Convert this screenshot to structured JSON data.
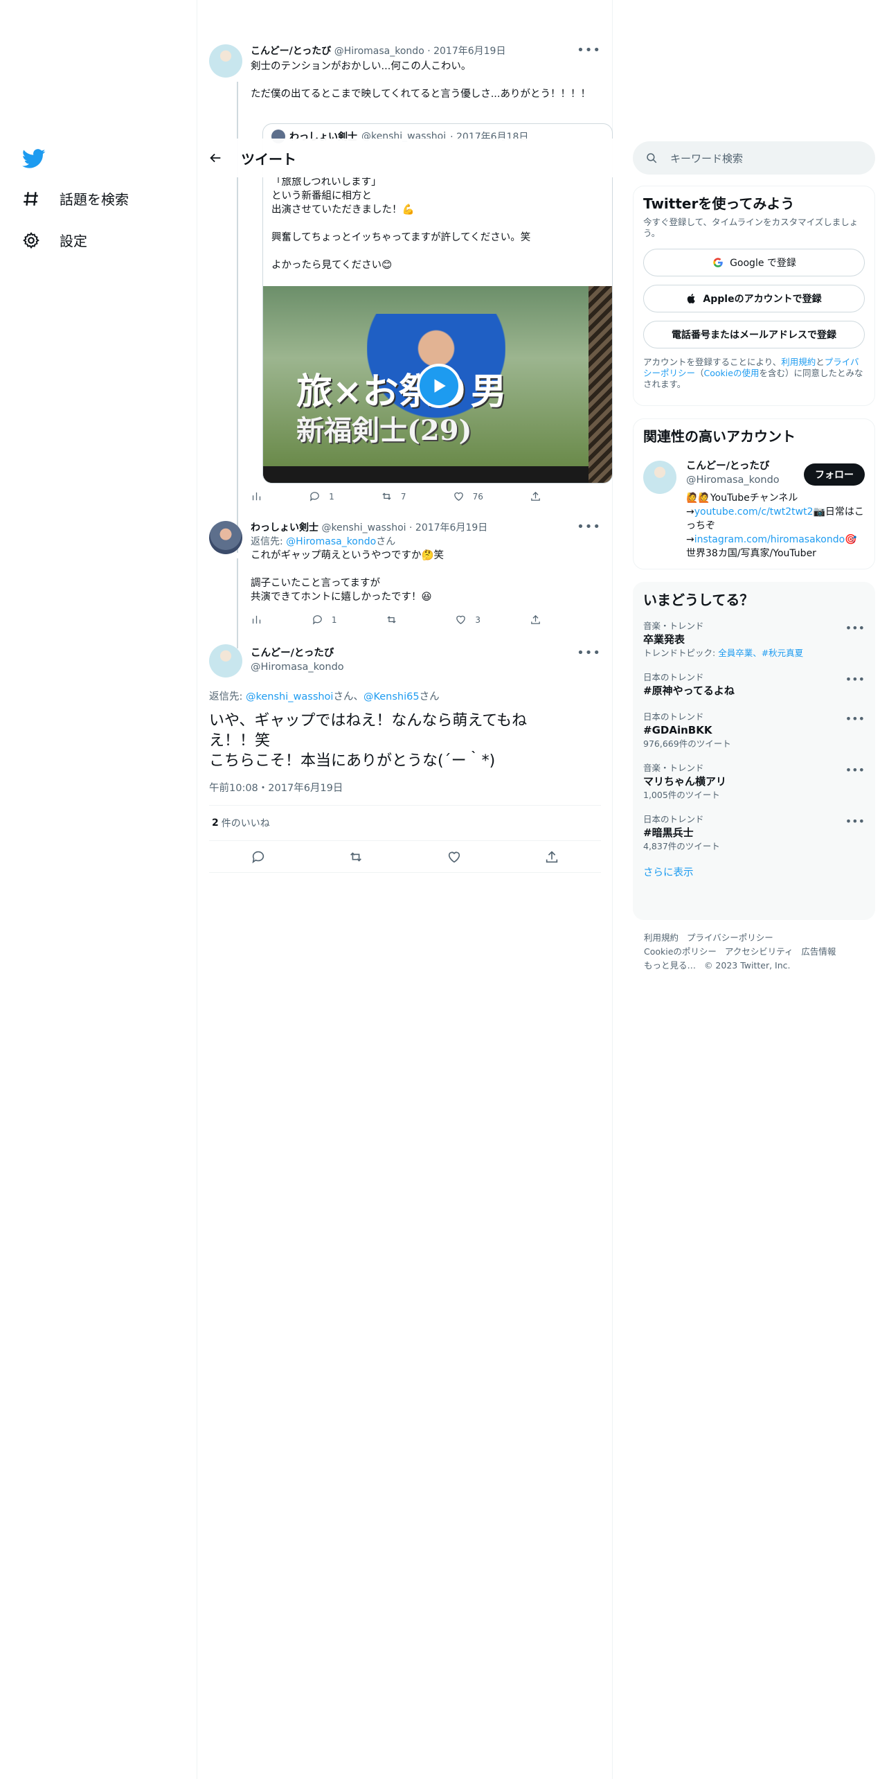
{
  "nav": {
    "explore": "話題を検索",
    "settings": "設定"
  },
  "header": {
    "title": "ツイート"
  },
  "tweet1": {
    "name": "こんどー/とったび",
    "handle": "@Hiromasa_kondo",
    "date": "· 2017年6月19日",
    "text": "剣士のテンションがおかしい...何この人こわい。\n\nただ僕の出てるとこまで映してくれてると言う優しさ...ありがとう！！！！",
    "quote": {
      "name": "わっしょい剣士",
      "handle": "@kenshi_wasshoi",
      "date": "· 2017年6月18日",
      "text": "「旅旅しつれいします」\nという新番組に相方と\n出演させていただきました！💪\n\n興奮してちょっとイッちゃってますが許してください。笑\n\nよかったら見てください😊",
      "overlay_line1": "旅×お祭り男",
      "overlay_line2": "新福剣士(29)"
    },
    "replies": "1",
    "retweets": "7",
    "likes": "76"
  },
  "tweet2": {
    "name": "わっしょい剣士",
    "handle": "@kenshi_wasshoi",
    "date": "· 2017年6月19日",
    "reply_prefix": "返信先: ",
    "reply_to": "@Hiromasa_kondo",
    "reply_suffix": "さん",
    "text": "これがギャップ萌えというやつですか🤔笑\n\n調子こいたこと言ってますが\n共演できてホントに嬉しかったです！😆",
    "replies": "1",
    "retweets": "",
    "likes": "3"
  },
  "main_tweet": {
    "name": "こんどー/とったび",
    "handle": "@Hiromasa_kondo",
    "reply_prefix": "返信先: ",
    "reply_to1": "@kenshi_wasshoi",
    "reply_mid": "さん、",
    "reply_to2": "@Kenshi65",
    "reply_suffix": "さん",
    "text": "いや、ギャップではねえ！なんなら萌えてもねえ！！笑\nこちらこそ！本当にありがとうな(´ー｀*)",
    "timestamp": "午前10:08・2017年6月19日",
    "likes_count": "2",
    "likes_label": "件のいいね"
  },
  "search": {
    "placeholder": "キーワード検索"
  },
  "signup": {
    "title": "Twitterを使ってみよう",
    "subtitle": "今すぐ登録して、タイムラインをカスタマイズしましょう。",
    "google": "Google で登録",
    "apple": "Appleのアカウントで登録",
    "phone": "電話番号またはメールアドレスで登録",
    "terms_pre": "アカウントを登録することにより、",
    "terms": "利用規約",
    "terms_and": "と",
    "privacy": "プライバシーポリシー",
    "cookie_pre": "（",
    "cookie": "Cookieの使用",
    "cookie_post": "を含む）に同意したとみなされます。"
  },
  "related": {
    "title": "関連性の高いアカウント",
    "name": "こんどー/とったび",
    "handle": "@Hiromasa_kondo",
    "follow": "フォロー",
    "bio1": "🙋🙋YouTubeチャンネル",
    "bio2_pre": "→",
    "bio2_link": "youtube.com/c/twt2twt2",
    "bio2_post": "📷日常はこっちぞ",
    "bio3_pre": "→",
    "bio3_link": "instagram.com/hiromasakondo",
    "bio3_post": "🎯",
    "bio4": "世界38カ国/写真家/YouTuber"
  },
  "trends": {
    "title": "いまどうしてる？",
    "items": [
      {
        "category": "音楽・トレンド",
        "name": "卒業発表",
        "extra_pre": "トレンドトピック: ",
        "extra_link": "全員卒業、#秋元真夏"
      },
      {
        "category": "日本のトレンド",
        "name": "#原神やってるよね",
        "count": ""
      },
      {
        "category": "日本のトレンド",
        "name": "#GDAinBKK",
        "count": "976,669件のツイート"
      },
      {
        "category": "音楽・トレンド",
        "name": "マリちゃん横アリ",
        "count": "1,005件のツイート"
      },
      {
        "category": "日本のトレンド",
        "name": "#暗黒兵士",
        "count": "4,837件のツイート"
      }
    ],
    "more": "さらに表示"
  },
  "footer": {
    "terms": "利用規約",
    "privacy": "プライバシーポリシー",
    "cookie": "Cookieのポリシー",
    "access": "アクセシビリティ",
    "ads": "広告情報",
    "more": "もっと見る…",
    "copyright": "© 2023 Twitter, Inc."
  },
  "colors": {
    "accent": "#1d9bf0",
    "text": "#0f1419",
    "muted": "#536471"
  }
}
